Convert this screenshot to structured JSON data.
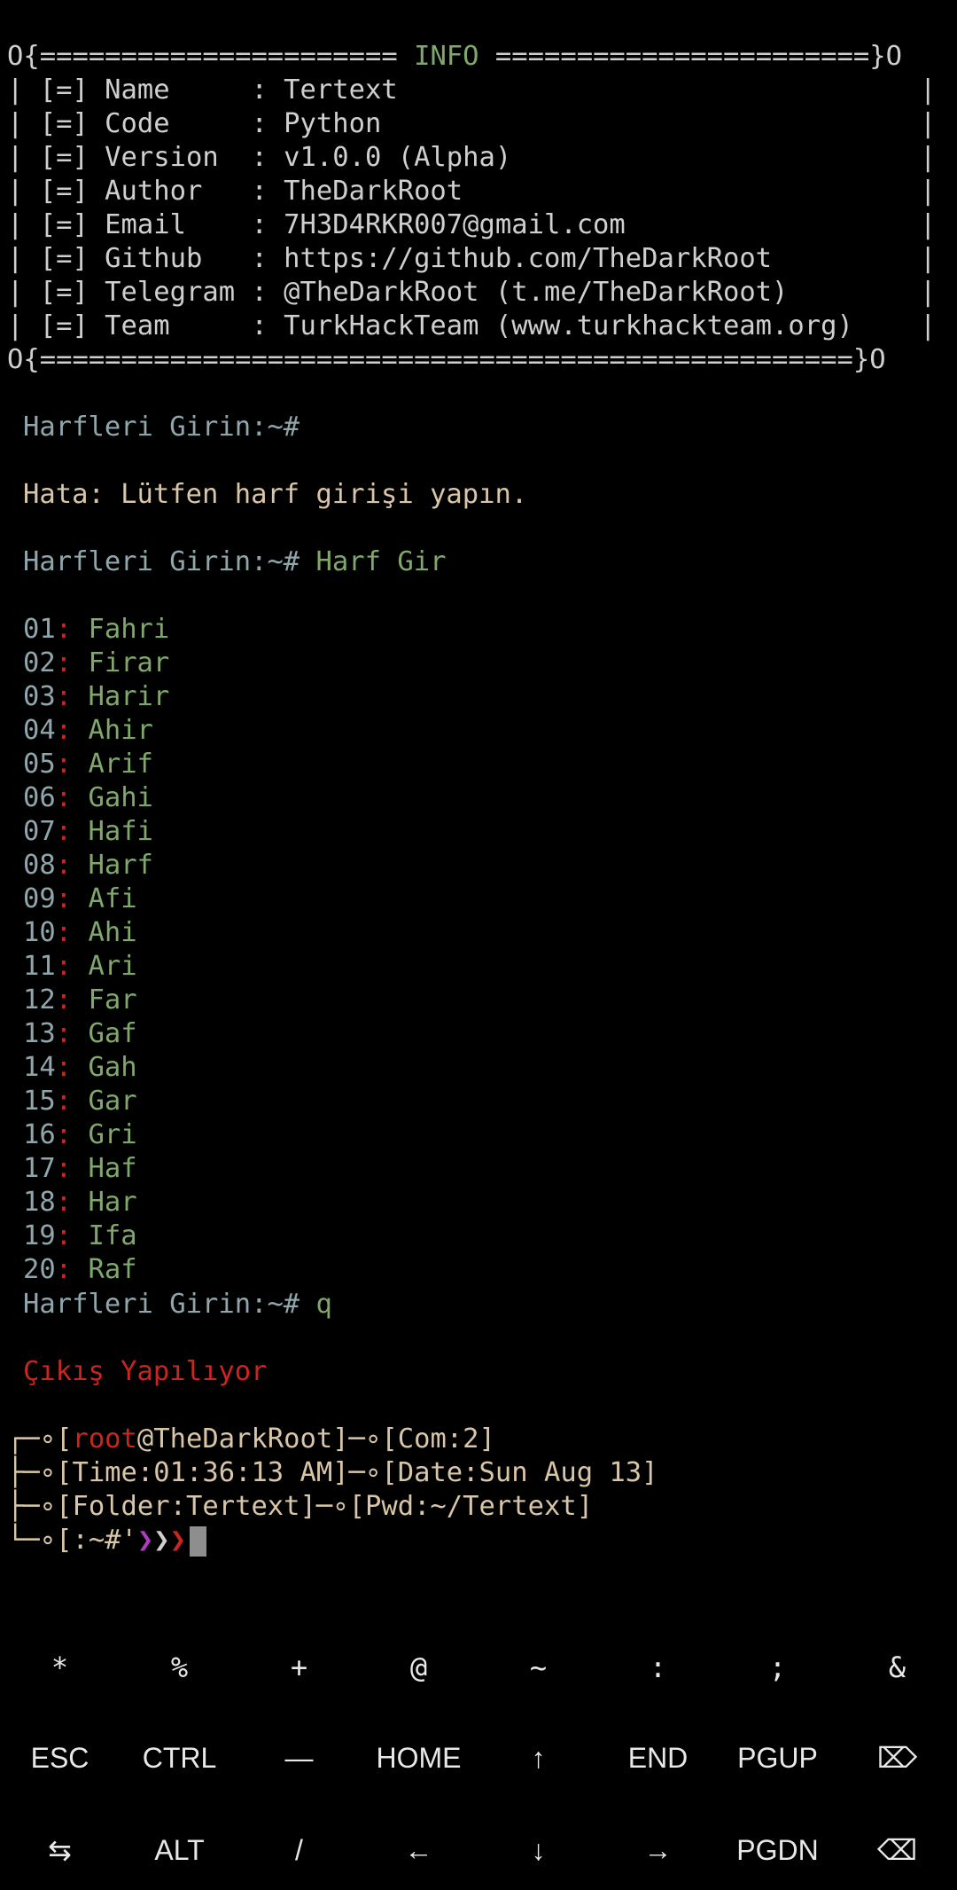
{
  "info_box": {
    "top_border_left": "O{====================== ",
    "title": "INFO",
    "top_border_right": " =======================}O",
    "rows": [
      {
        "label": "| [=] Name     : ",
        "value": "Tertext",
        "end": "|"
      },
      {
        "label": "| [=] Code     : ",
        "value": "Python",
        "end": "|"
      },
      {
        "label": "| [=] Version  : ",
        "value": "v1.0.0 (Alpha)",
        "end": "|"
      },
      {
        "label": "| [=] Author   : ",
        "value": "TheDarkRoot",
        "end": "|"
      },
      {
        "label": "| [=] Email    : ",
        "value": "7H3D4RKR007@gmail.com",
        "end": "|"
      },
      {
        "label": "| [=] Github   : ",
        "value": "https://github.com/TheDarkRoot",
        "end": "|"
      },
      {
        "label": "| [=] Telegram : ",
        "value": "@TheDarkRoot (t.me/TheDarkRoot)",
        "end": "|"
      },
      {
        "label": "| [=] Team     : ",
        "value": "TurkHackTeam (www.turkhackteam.org)",
        "end": "|"
      }
    ],
    "bottom_border": "O{==================================================}O"
  },
  "session": {
    "prompt1": "Harfleri Girin:~#",
    "error": "Hata: Lütfen harf girişi yapın.",
    "prompt2": "Harfleri Girin:~#",
    "input2": " Harf Gir",
    "results": [
      {
        "num": "01",
        "word": "Fahri"
      },
      {
        "num": "02",
        "word": "Firar"
      },
      {
        "num": "03",
        "word": "Harir"
      },
      {
        "num": "04",
        "word": "Ahir"
      },
      {
        "num": "05",
        "word": "Arif"
      },
      {
        "num": "06",
        "word": "Gahi"
      },
      {
        "num": "07",
        "word": "Hafi"
      },
      {
        "num": "08",
        "word": "Harf"
      },
      {
        "num": "09",
        "word": "Afi"
      },
      {
        "num": "10",
        "word": "Ahi"
      },
      {
        "num": "11",
        "word": "Ari"
      },
      {
        "num": "12",
        "word": "Far"
      },
      {
        "num": "13",
        "word": "Gaf"
      },
      {
        "num": "14",
        "word": "Gah"
      },
      {
        "num": "15",
        "word": "Gar"
      },
      {
        "num": "16",
        "word": "Gri"
      },
      {
        "num": "17",
        "word": "Haf"
      },
      {
        "num": "18",
        "word": "Har"
      },
      {
        "num": "19",
        "word": "Ifa"
      },
      {
        "num": "20",
        "word": "Raf"
      }
    ],
    "colon": ": ",
    "prompt3": "Harfleri Girin:~#",
    "input3": " q",
    "exit_msg": "Çıkış Yapılıyor"
  },
  "shell_prompt": {
    "line1_pre": "┌─∘[",
    "user": "root",
    "host": "@TheDarkRoot",
    "line1_post": "]─∘[Com:2]",
    "line2": "├─∘[Time:01:36:13 AM]─∘[Date:Sun Aug 13]",
    "line3": "├─∘[Folder:Tertext]─∘[Pwd:~/Tertext]",
    "line4_pre": "└─∘[:~#",
    "tick": "'",
    "arrow1": "❯",
    "arrow2": "❯",
    "arrow3": "❯"
  },
  "extra_keys": {
    "row1": [
      "*",
      "%",
      "+",
      "@",
      "~",
      ":",
      ";",
      "&"
    ],
    "row2": [
      "ESC",
      "CTRL",
      "—",
      "HOME",
      "↑",
      "END",
      "PGUP",
      "⌦"
    ],
    "row3": [
      "⇆",
      "ALT",
      "/",
      "←",
      "↓",
      "→",
      "PGDN",
      "⌫"
    ]
  },
  "colors": {
    "background": "#000000",
    "green": "#7fa86a",
    "prompt": "#8fa6ad",
    "error": "#d8c6a6",
    "red": "#c8261f",
    "purple": "#b03ac2"
  }
}
